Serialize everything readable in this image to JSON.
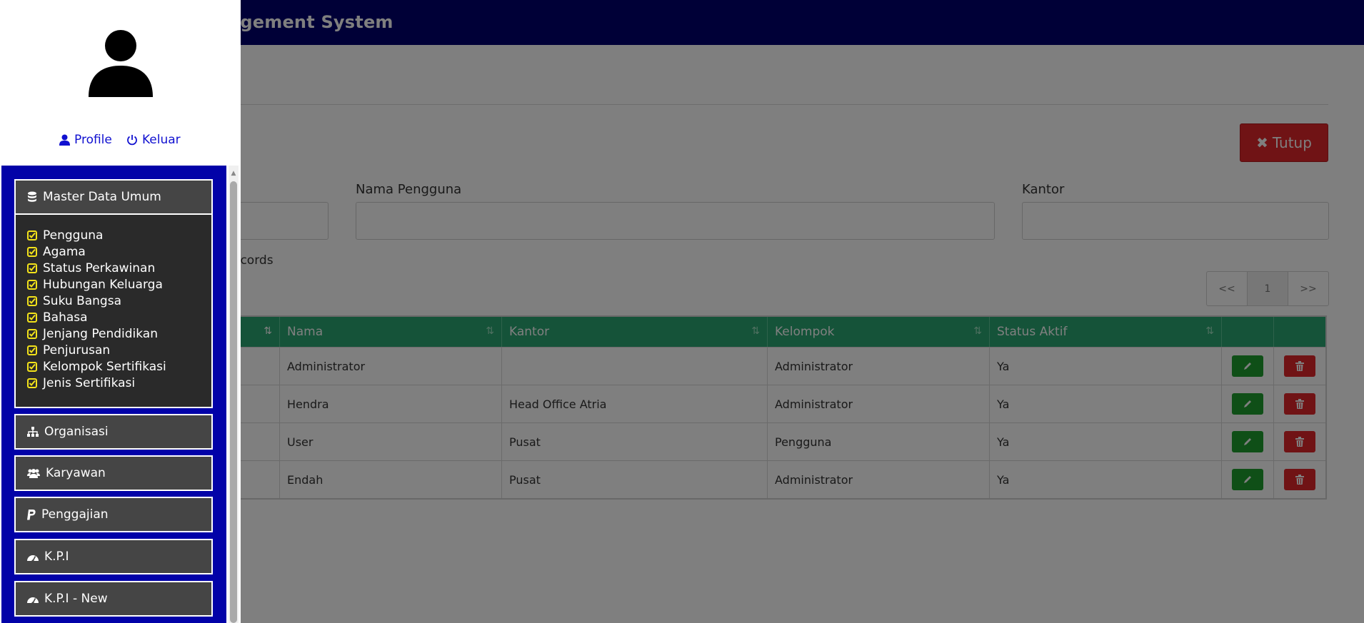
{
  "header": {
    "title": "agement System"
  },
  "actions": {
    "close_label": "Tutup"
  },
  "filters": {
    "name_label": "Nama Pengguna",
    "office_label": "Kantor"
  },
  "records": {
    "text": "ecords"
  },
  "pagination": {
    "prev": "<<",
    "current": "1",
    "next": ">>"
  },
  "table": {
    "columns": [
      "",
      "Nama",
      "Kantor",
      "Kelompok",
      "Status Aktif",
      "",
      ""
    ],
    "rows": [
      {
        "nama": "Administrator",
        "kantor": "",
        "kelompok": "Administrator",
        "status": "Ya"
      },
      {
        "nama": "Hendra",
        "kantor": "Head Office Atria",
        "kelompok": "Administrator",
        "status": "Ya"
      },
      {
        "nama": "User",
        "kantor": "Pusat",
        "kelompok": "Pengguna",
        "status": "Ya"
      },
      {
        "nama": "Endah",
        "kantor": "Pusat",
        "kelompok": "Administrator",
        "status": "Ya"
      }
    ]
  },
  "sidebar": {
    "profile_label": "Profile",
    "logout_label": "Keluar",
    "menu": [
      {
        "label": "Master Data Umum",
        "icon": "database-icon"
      },
      {
        "label": "Organisasi",
        "icon": "sitemap-icon"
      },
      {
        "label": "Karyawan",
        "icon": "users-icon"
      },
      {
        "label": "Penggajian",
        "icon": "paypal-icon"
      },
      {
        "label": "K.P.I",
        "icon": "dashboard-icon"
      },
      {
        "label": "K.P.I - New",
        "icon": "dashboard-icon"
      }
    ],
    "submenu": [
      "Pengguna",
      "Agama",
      "Status Perkawinan",
      "Hubungan Keluarga",
      "Suku Bangsa",
      "Bahasa",
      "Jenjang Pendidikan",
      "Penjurusan",
      "Kelompok Sertifikasi",
      "Jenis Sertifikasi"
    ]
  },
  "colors": {
    "header": "#00006e",
    "sidebar_panel": "#0202a8",
    "table_header": "#2aa772",
    "edit": "#1e9e2e",
    "delete": "#e0262b"
  }
}
